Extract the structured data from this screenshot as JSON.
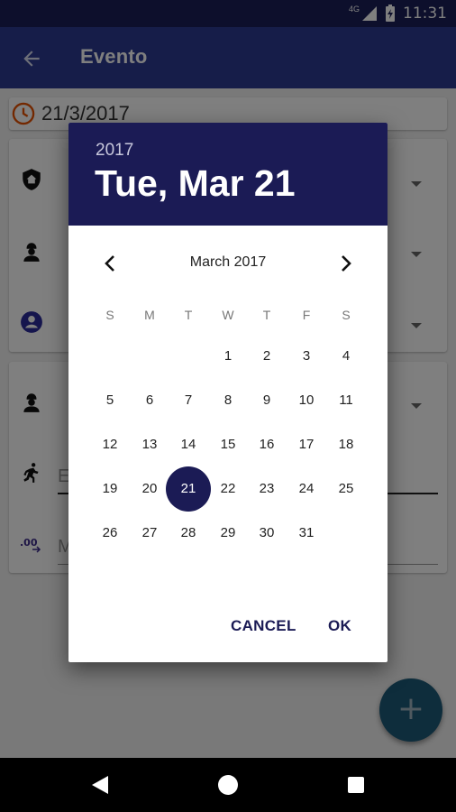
{
  "status_bar": {
    "network": "4G",
    "time": "11:31"
  },
  "app_bar": {
    "title": "Evento"
  },
  "form": {
    "date_value": "21/3/2017",
    "field_hint_1": "E",
    "field_hint_2": "M"
  },
  "date_picker": {
    "year": "2017",
    "selected_date": "Tue, Mar 21",
    "month_label": "March 2017",
    "weekdays": [
      "S",
      "M",
      "T",
      "W",
      "T",
      "F",
      "S"
    ],
    "weeks": [
      [
        "",
        "",
        "",
        "1",
        "2",
        "3",
        "4"
      ],
      [
        "5",
        "6",
        "7",
        "8",
        "9",
        "10",
        "11"
      ],
      [
        "12",
        "13",
        "14",
        "15",
        "16",
        "17",
        "18"
      ],
      [
        "19",
        "20",
        "21",
        "22",
        "23",
        "24",
        "25"
      ],
      [
        "26",
        "27",
        "28",
        "29",
        "30",
        "31",
        ""
      ]
    ],
    "selected_day": "21",
    "cancel_label": "CANCEL",
    "ok_label": "OK"
  },
  "fab": {
    "label": "+"
  },
  "colors": {
    "app_bar": "#2c3a92",
    "dialog_header": "#1b1b55",
    "accent": "#1b1b55",
    "clock_icon": "#e65100",
    "fab": "#1c5a78"
  },
  "icons": [
    "back-arrow-icon",
    "clock-icon",
    "shield-home-icon",
    "worker-icon",
    "account-circle-icon",
    "running-person-icon",
    "decimal-icon",
    "chevron-left-icon",
    "chevron-right-icon",
    "add-icon"
  ]
}
